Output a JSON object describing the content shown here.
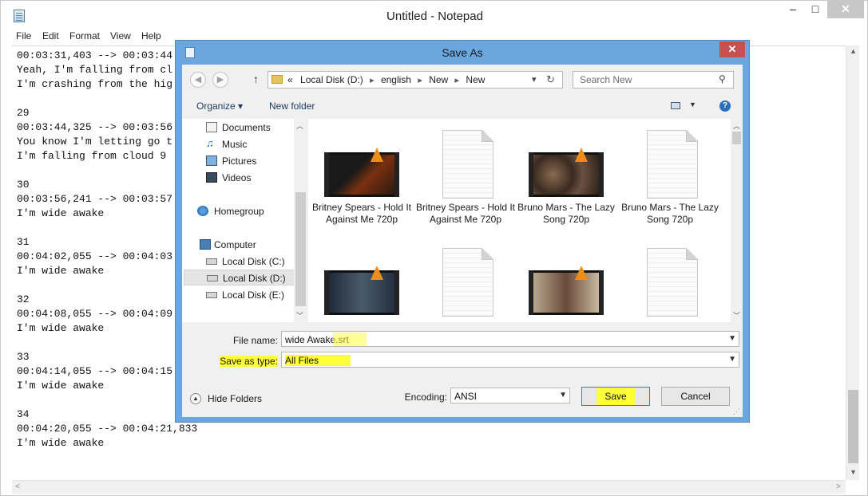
{
  "notepad": {
    "title": "Untitled - Notepad",
    "controls": {
      "minimize": "–",
      "maximize": "□",
      "close": "✕"
    },
    "menu": [
      "File",
      "Edit",
      "Format",
      "View",
      "Help"
    ],
    "lines": [
      "00:03:31,403 --> 00:03:44",
      "Yeah, I'm falling from cl",
      "I'm crashing from the hig",
      "",
      "29",
      "00:03:44,325 --> 00:03:56",
      "You know I'm letting go t",
      "I'm falling from cloud 9",
      "",
      "30",
      "00:03:56,241 --> 00:03:57",
      "I'm wide awake",
      "",
      "31",
      "00:04:02,055 --> 00:04:03",
      "I'm wide awake",
      "",
      "32",
      "00:04:08,055 --> 00:04:09",
      "I'm wide awake",
      "",
      "33",
      "00:04:14,055 --> 00:04:15",
      "I'm wide awake",
      "",
      "34",
      "00:04:20,055 --> 00:04:21,833",
      "I'm wide awake"
    ]
  },
  "dialog": {
    "title": "Save As",
    "close": "✕",
    "address": {
      "crumbs": [
        "«",
        "Local Disk (D:)",
        "english",
        "New",
        "New"
      ]
    },
    "search_placeholder": "Search New",
    "toolbar": {
      "organize": "Organize ▾",
      "new_folder": "New folder",
      "help": "?"
    },
    "nav_items": [
      {
        "label": "Documents",
        "icon": "documents-icon"
      },
      {
        "label": "Music",
        "icon": "music-icon"
      },
      {
        "label": "Pictures",
        "icon": "pictures-icon"
      },
      {
        "label": "Videos",
        "icon": "videos-icon"
      },
      {
        "label": "Homegroup",
        "icon": "homegroup-icon"
      },
      {
        "label": "Computer",
        "icon": "computer-icon"
      },
      {
        "label": "Local Disk (C:)",
        "icon": "drive-icon"
      },
      {
        "label": "Local Disk (D:)",
        "icon": "drive-icon",
        "selected": true
      },
      {
        "label": "Local Disk (E:)",
        "icon": "drive-icon"
      }
    ],
    "files": [
      {
        "name": "Britney Spears - Hold It Against Me 720p",
        "kind": "video"
      },
      {
        "name": "Britney Spears - Hold It Against Me 720p",
        "kind": "document"
      },
      {
        "name": "Bruno Mars - The Lazy Song 720p",
        "kind": "video"
      },
      {
        "name": "Bruno Mars - The Lazy Song 720p",
        "kind": "document"
      },
      {
        "name": "",
        "kind": "video"
      },
      {
        "name": "",
        "kind": "document"
      },
      {
        "name": "",
        "kind": "video"
      },
      {
        "name": "",
        "kind": "document"
      }
    ],
    "file_name_label": "File name:",
    "file_name_value": "wide Awake.srt",
    "save_type_label": "Save as type:",
    "save_type_value": "All Files",
    "hide_folders": "Hide Folders",
    "encoding_label": "Encoding:",
    "encoding_value": "ANSI",
    "save_button": "Save",
    "cancel_button": "Cancel",
    "highlight_color": "#ffff3a"
  }
}
